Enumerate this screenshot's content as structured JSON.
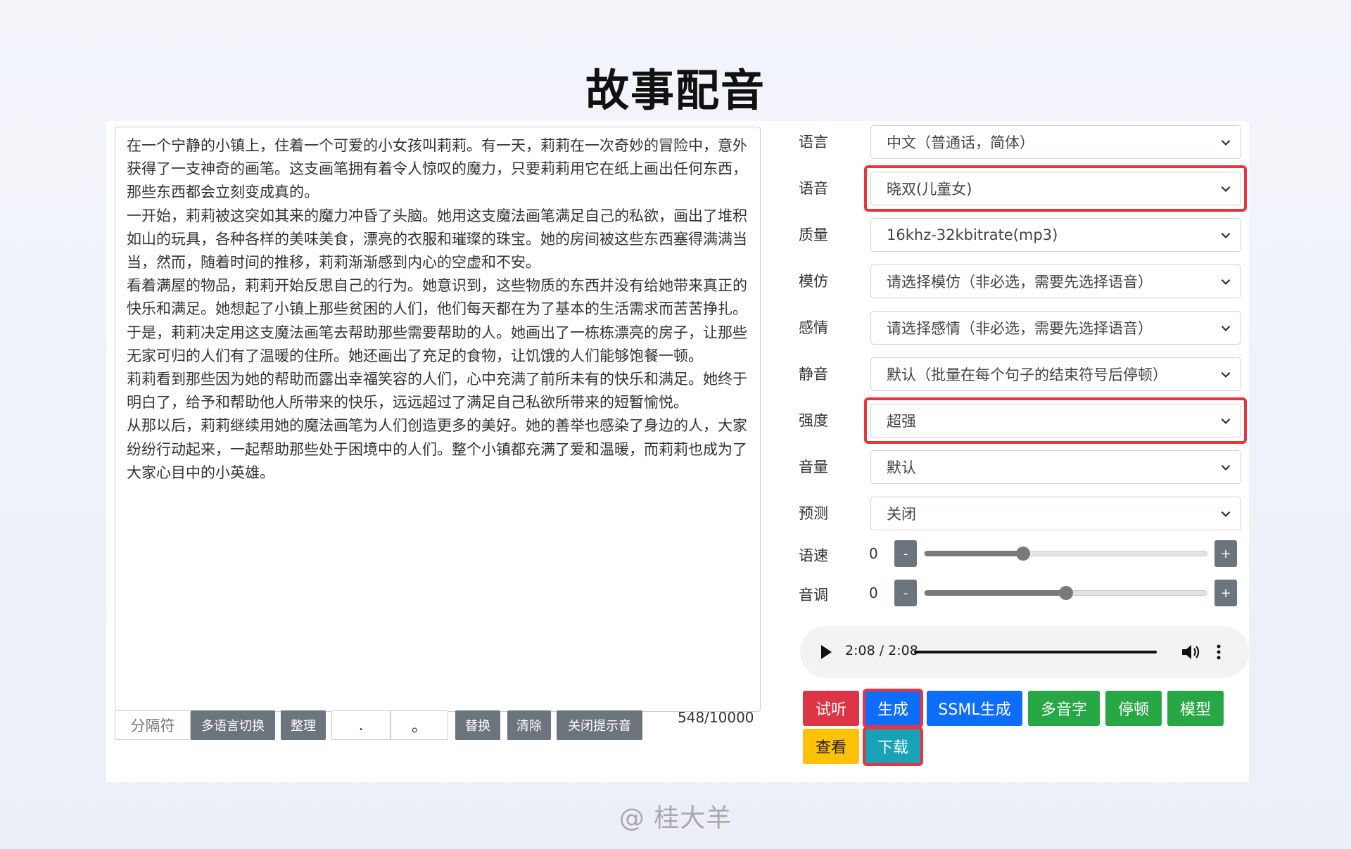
{
  "title": "故事配音",
  "editor": {
    "paragraphs": [
      "在一个宁静的小镇上，住着一个可爱的小女孩叫莉莉。有一天，莉莉在一次奇妙的冒险中，意外获得了一支神奇的画笔。这支画笔拥有着令人惊叹的魔力，只要莉莉用它在纸上画出任何东西，那些东西都会立刻变成真的。",
      "一开始，莉莉被这突如其来的魔力冲昏了头脑。她用这支魔法画笔满足自己的私欲，画出了堆积如山的玩具，各种各样的美味美食，漂亮的衣服和璀璨的珠宝。她的房间被这些东西塞得满满当当，然而，随着时间的推移，莉莉渐渐感到内心的空虚和不安。",
      "看着满屋的物品，莉莉开始反思自己的行为。她意识到，这些物质的东西并没有给她带来真正的快乐和满足。她想起了小镇上那些贫困的人们，他们每天都在为了基本的生活需求而苦苦挣扎。",
      "于是，莉莉决定用这支魔法画笔去帮助那些需要帮助的人。她画出了一栋栋漂亮的房子，让那些无家可归的人们有了温暖的住所。她还画出了充足的食物，让饥饿的人们能够饱餐一顿。",
      "莉莉看到那些因为她的帮助而露出幸福笑容的人们，心中充满了前所未有的快乐和满足。她终于明白了，给予和帮助他人所带来的快乐，远远超过了满足自己私欲所带来的短暂愉悦。",
      "从那以后，莉莉继续用她的魔法画笔为人们创造更多的美好。她的善举也感染了身边的人，大家纷纷行动起来，一起帮助那些处于困境中的人们。整个小镇都充满了爱和温暖，而莉莉也成为了大家心目中的小英雄。"
    ]
  },
  "toolbar": {
    "separator": "分隔符",
    "multi_lang": "多语言切换",
    "tidy": "整理",
    "find_value": ".",
    "replace_value": "。",
    "replace": "替换",
    "clear": "清除",
    "close_tip": "关闭提示音",
    "counter": "548/10000"
  },
  "form": {
    "rows": [
      {
        "label": "语言",
        "value": "中文（普通话，简体）"
      },
      {
        "label": "语音",
        "value": "晓双(儿童女)"
      },
      {
        "label": "质量",
        "value": "16khz-32kbitrate(mp3)"
      },
      {
        "label": "模仿",
        "value": "请选择模仿（非必选，需要先选择语音）"
      },
      {
        "label": "感情",
        "value": "请选择感情（非必选，需要先选择语音）"
      },
      {
        "label": "静音",
        "value": "默认（批量在每个句子的结束符号后停顿）"
      },
      {
        "label": "强度",
        "value": "超强"
      },
      {
        "label": "音量",
        "value": "默认"
      },
      {
        "label": "预测",
        "value": "关闭"
      }
    ],
    "sliders": [
      {
        "label": "语速",
        "value": "0",
        "level": 0.35
      },
      {
        "label": "音调",
        "value": "0",
        "level": 0.5
      }
    ],
    "minus": "-",
    "plus": "+"
  },
  "audio": {
    "time": "2:08 / 2:08",
    "progress": 1.0
  },
  "buttons": {
    "listen": "试听",
    "generate": "生成",
    "ssml": "SSML生成",
    "polyphone": "多音字",
    "pause": "停顿",
    "model": "模型",
    "view": "查看",
    "download": "下载"
  },
  "colors": {
    "highlight": "#e8343f",
    "red": "#dc3545",
    "blue": "#0d6efd",
    "green": "#28a745",
    "yellow": "#ffc107",
    "teal": "#17a2b8",
    "gray": "#6c757d"
  },
  "watermark": "@ 桂大羊"
}
